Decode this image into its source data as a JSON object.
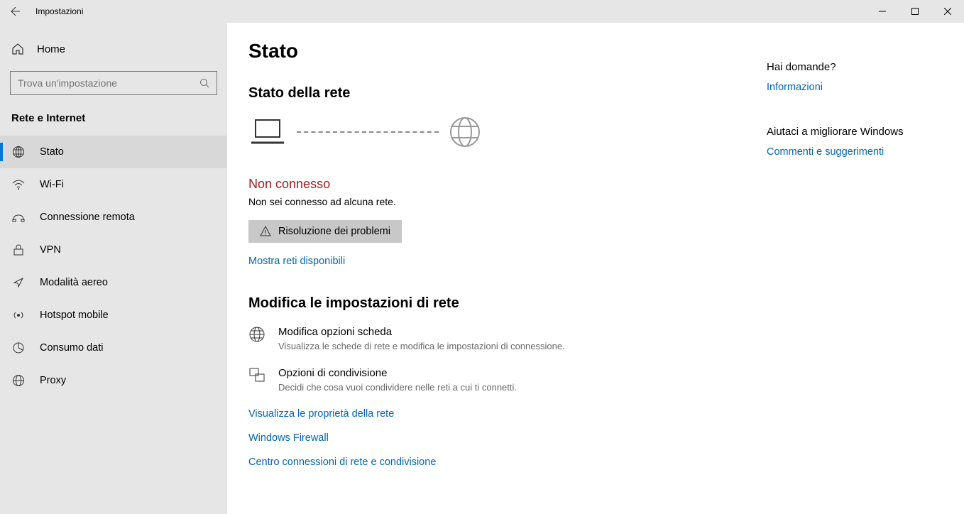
{
  "window": {
    "title": "Impostazioni"
  },
  "sidebar": {
    "home": "Home",
    "search_placeholder": "Trova un'impostazione",
    "section": "Rete e Internet",
    "items": [
      {
        "label": "Stato"
      },
      {
        "label": "Wi-Fi"
      },
      {
        "label": "Connessione remota"
      },
      {
        "label": "VPN"
      },
      {
        "label": "Modalità aereo"
      },
      {
        "label": "Hotspot mobile"
      },
      {
        "label": "Consumo dati"
      },
      {
        "label": "Proxy"
      }
    ]
  },
  "main": {
    "page_title": "Stato",
    "status_heading": "Stato della rete",
    "not_connected": "Non connesso",
    "not_connected_desc": "Non sei connesso ad alcuna rete.",
    "troubleshoot": "Risoluzione dei problemi",
    "show_networks": "Mostra reti disponibili",
    "change_heading": "Modifica le impostazioni di rete",
    "adapter_title": "Modifica opzioni scheda",
    "adapter_desc": "Visualizza le schede di rete e modifica le impostazioni di connessione.",
    "sharing_title": "Opzioni di condivisione",
    "sharing_desc": "Decidi che cosa vuoi condividere nelle reti a cui ti connetti.",
    "view_props": "Visualizza le proprietà della rete",
    "firewall": "Windows Firewall",
    "center": "Centro connessioni di rete e condivisione"
  },
  "right": {
    "q_head": "Hai domande?",
    "q_link": "Informazioni",
    "fb_head": "Aiutaci a migliorare Windows",
    "fb_link": "Commenti e suggerimenti"
  }
}
